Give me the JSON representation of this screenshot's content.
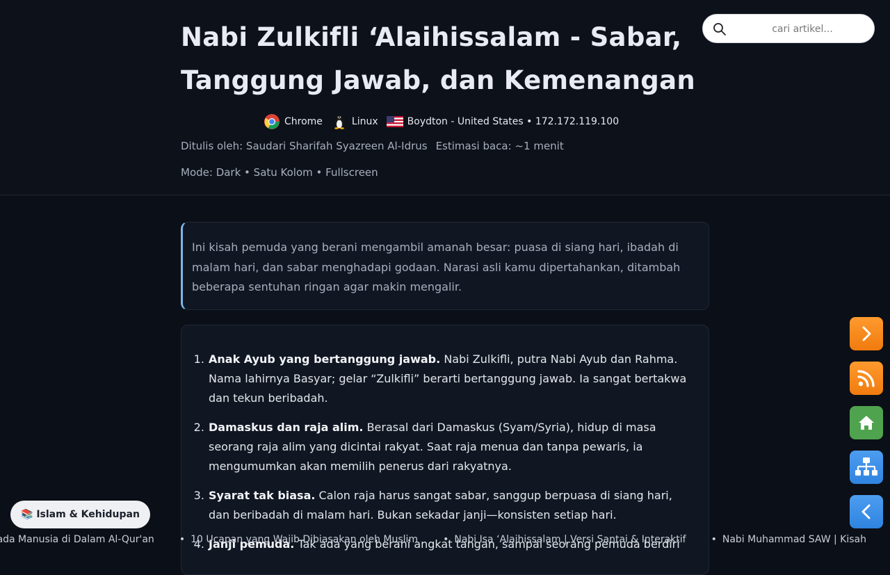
{
  "article": {
    "title": "Nabi Zulkifli ‘Alaihissalam - Sabar, Tanggung Jawab, dan Kemenangan",
    "visitor": {
      "browser": "Chrome",
      "os": "Linux",
      "location": "Boydton - United States",
      "separator": "•",
      "ip": "172.172.119.100"
    },
    "author": "Ditulis oleh: Saudari Sharifah Syazreen Al-Idrus",
    "read_time": "Estimasi baca: ~1 menit",
    "mode": "Mode: Dark • Satu Kolom • Fullscreen",
    "intro": "Ini kisah pemuda yang berani mengambil amanah besar: puasa di siang hari, ibadah di malam hari, dan sabar menghadapi godaan. Narasi asli kamu dipertahankan, ditambah beberapa sentuhan ringan agar makin mengalir.",
    "points": [
      {
        "title": "Anak Ayub yang bertanggung jawab.",
        "text": "Nabi Zulkifli, putra Nabi Ayub dan Rahma. Nama lahirnya Basyar; gelar “Zulkifli” berarti bertanggung jawab. Ia sangat bertakwa dan tekun beribadah."
      },
      {
        "title": "Damaskus dan raja alim.",
        "text": "Berasal dari Damaskus (Syam/Syria), hidup di masa seorang raja alim yang dicintai rakyat. Saat raja menua dan tanpa pewaris, ia mengumumkan akan memilih penerus dari rakyatnya."
      },
      {
        "title": "Syarat tak biasa.",
        "text": "Calon raja harus sangat sabar, sanggup berpuasa di siang hari, dan beribadah di malam hari. Bukan sekadar janji—konsisten setiap hari."
      },
      {
        "title": "Janji pemuda.",
        "text": "Tak ada yang berani angkat tangan, sampai seorang pemuda berdiri"
      }
    ]
  },
  "search": {
    "placeholder": "cari artikel..."
  },
  "category": {
    "icon": "📚",
    "label": "Islam & Kehidupan"
  },
  "side_buttons": {
    "next": "chevron-right-icon",
    "rss": "rss-icon",
    "home": "home-icon",
    "sitemap": "sitemap-icon",
    "prev": "chevron-left-icon"
  },
  "ticker": [
    "h Allah Kepada Manusia di Dalam Al-Qur'an",
    "10 Ucapan yang Wajib Dibiasakan oleh Muslim",
    "Nabi Isa ‘Alaihissalam | Versi Santai & Interaktif",
    "Nabi Muhammad SAW | Kisah"
  ],
  "colors": {
    "background": "#0b0f17",
    "accent_orange": "#f07b0e",
    "accent_green": "#4fa34e",
    "accent_blue": "#2f84e0",
    "intro_border": "#7ab7e8"
  }
}
